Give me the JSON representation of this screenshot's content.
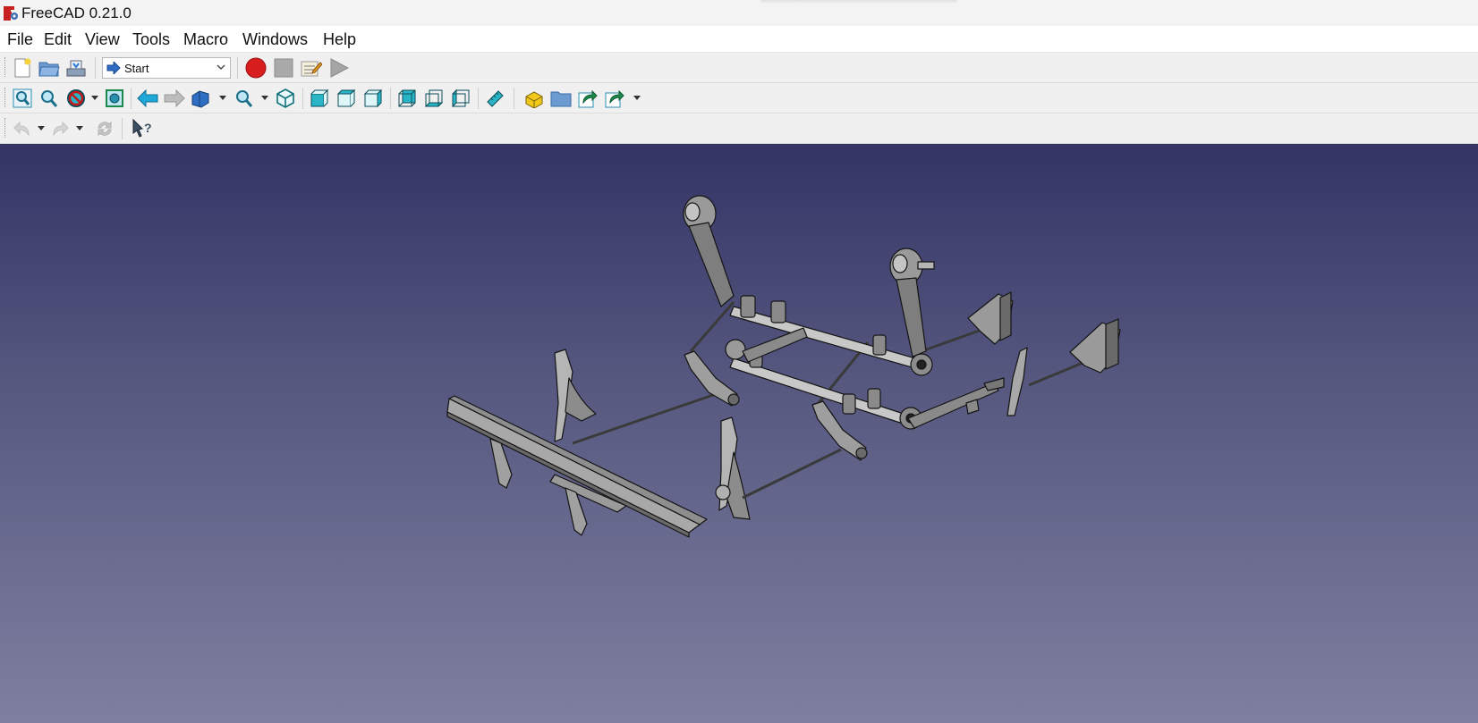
{
  "window": {
    "title": "FreeCAD 0.21.0"
  },
  "menubar": {
    "items": [
      "File",
      "Edit",
      "View",
      "Tools",
      "Macro",
      "Windows",
      "Help"
    ]
  },
  "toolbar": {
    "workbench_selector": {
      "value": "Start"
    }
  },
  "colors": {
    "viewport_top": "#333465",
    "viewport_bottom": "#7f7fa0",
    "macro_record": "#d81e1e",
    "view_icon_cyan": "#2ab5c6",
    "nav_arrow": "#1ea8d8"
  },
  "icons": {
    "file_toolbar": [
      "new-document-icon",
      "open-folder-icon",
      "save-icon"
    ],
    "macro_toolbar": [
      "macro-record-icon",
      "macro-stop-icon",
      "macro-edit-icon",
      "macro-run-icon"
    ],
    "view_toolbar": [
      "fit-all-icon",
      "fit-selection-icon",
      "draw-style-icon",
      "bounding-box-icon",
      "back-icon",
      "forward-icon",
      "sync-view-icon",
      "zoom-icon",
      "isometric-icon",
      "front-view-icon",
      "top-view-icon",
      "right-view-icon",
      "rear-view-icon",
      "bottom-view-icon",
      "left-view-icon",
      "measure-icon"
    ],
    "structure_toolbar": [
      "part-icon",
      "group-icon",
      "link-icon",
      "link-actions-icon"
    ],
    "edit_toolbar": [
      "undo-icon",
      "redo-icon",
      "refresh-icon",
      "whats-this-icon"
    ]
  }
}
